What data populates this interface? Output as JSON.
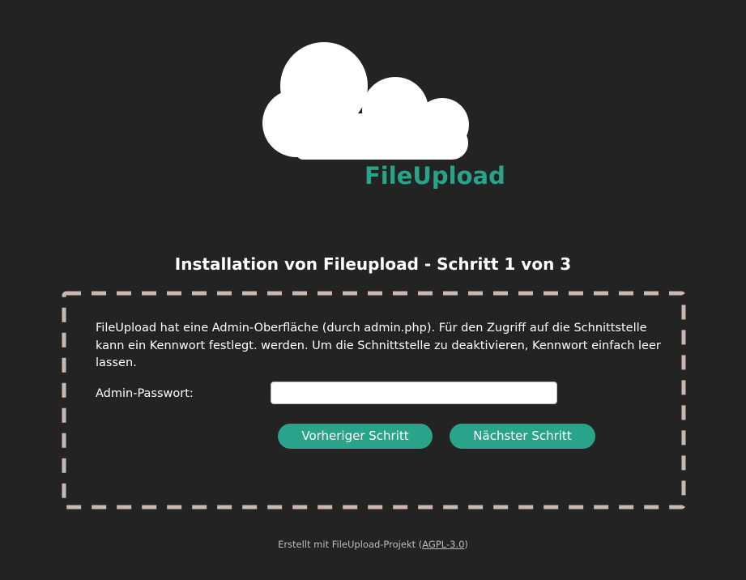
{
  "app": {
    "brand_name": "FileUpload",
    "logo_icon": "cloud-icon",
    "colors": {
      "background": "#232323",
      "accent": "#2aa38b",
      "border_dash": "#c8b8b0",
      "text": "#ffffff",
      "footer_text": "#bdbdbd"
    }
  },
  "install": {
    "heading": "Installation von Fileupload - Schritt 1 von 3",
    "description": "FileUpload hat eine Admin-Oberfläche (durch admin.php). Für den Zugriff auf die Schnittstelle kann ein Kennwort festlegt. werden. Um die Schnittstelle zu deaktivieren, Kennwort einfach leer lassen.",
    "password_label": "Admin-Passwort:",
    "password_value": "",
    "prev_button": "Vorheriger Schritt",
    "next_button": "Nächster Schritt"
  },
  "footer": {
    "text_before": "Erstellt mit FileUpload-Projekt (",
    "license_link": "AGPL-3.0",
    "text_after": ")"
  }
}
